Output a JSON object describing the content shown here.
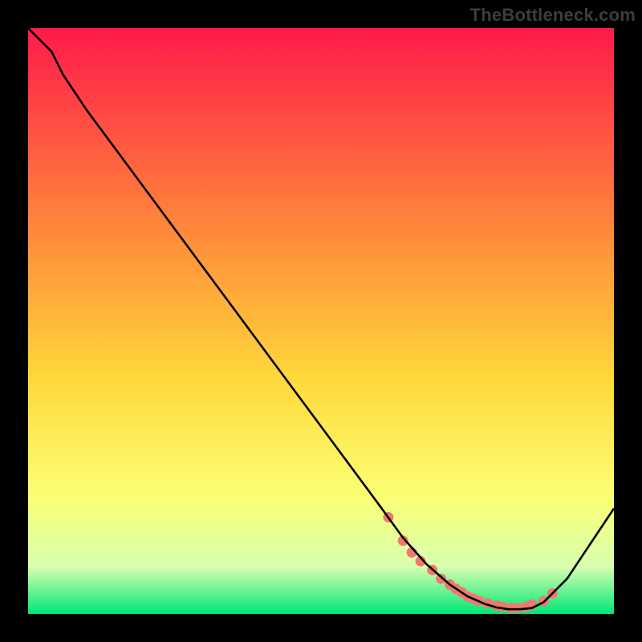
{
  "watermark": "TheBottleneck.com",
  "colors": {
    "frame": "#000000",
    "curve": "#000000",
    "dots": "#f2786f",
    "grad_top": "#ff1a4b",
    "grad_mid1": "#ff8a3a",
    "grad_mid2": "#ffd93b",
    "grad_mid3": "#fbff74",
    "grad_mid4": "#d7ffb0",
    "grad_bottom": "#00e676"
  },
  "chart_data": {
    "type": "line",
    "title": "",
    "xlabel": "",
    "ylabel": "",
    "xlim": [
      0,
      100
    ],
    "ylim": [
      0,
      100
    ],
    "series": [
      {
        "name": "bottleneck-curve",
        "x": [
          0,
          4,
          6,
          10,
          20,
          30,
          40,
          50,
          60,
          64,
          68,
          72,
          75,
          78,
          80,
          82,
          84,
          86,
          88,
          92,
          96,
          100
        ],
        "y": [
          100,
          96,
          92,
          86,
          72.5,
          59,
          45.5,
          32,
          18.5,
          13,
          8.5,
          5,
          3,
          1.7,
          1.1,
          0.8,
          0.8,
          1,
          2,
          6,
          12,
          18
        ]
      }
    ],
    "points": {
      "name": "highlighted-dots",
      "x": [
        61.5,
        64,
        65.5,
        67,
        69,
        70.5,
        72,
        73,
        74,
        75,
        76,
        77,
        78.5,
        80,
        81,
        82.5,
        83.5,
        85,
        86,
        88,
        89.5
      ],
      "y": [
        16.5,
        12.5,
        10.5,
        9,
        7.5,
        6,
        5,
        4.3,
        3.7,
        3,
        2.6,
        2.2,
        1.8,
        1.4,
        1.2,
        1,
        1,
        1.2,
        1.6,
        2.2,
        3.5
      ]
    }
  }
}
